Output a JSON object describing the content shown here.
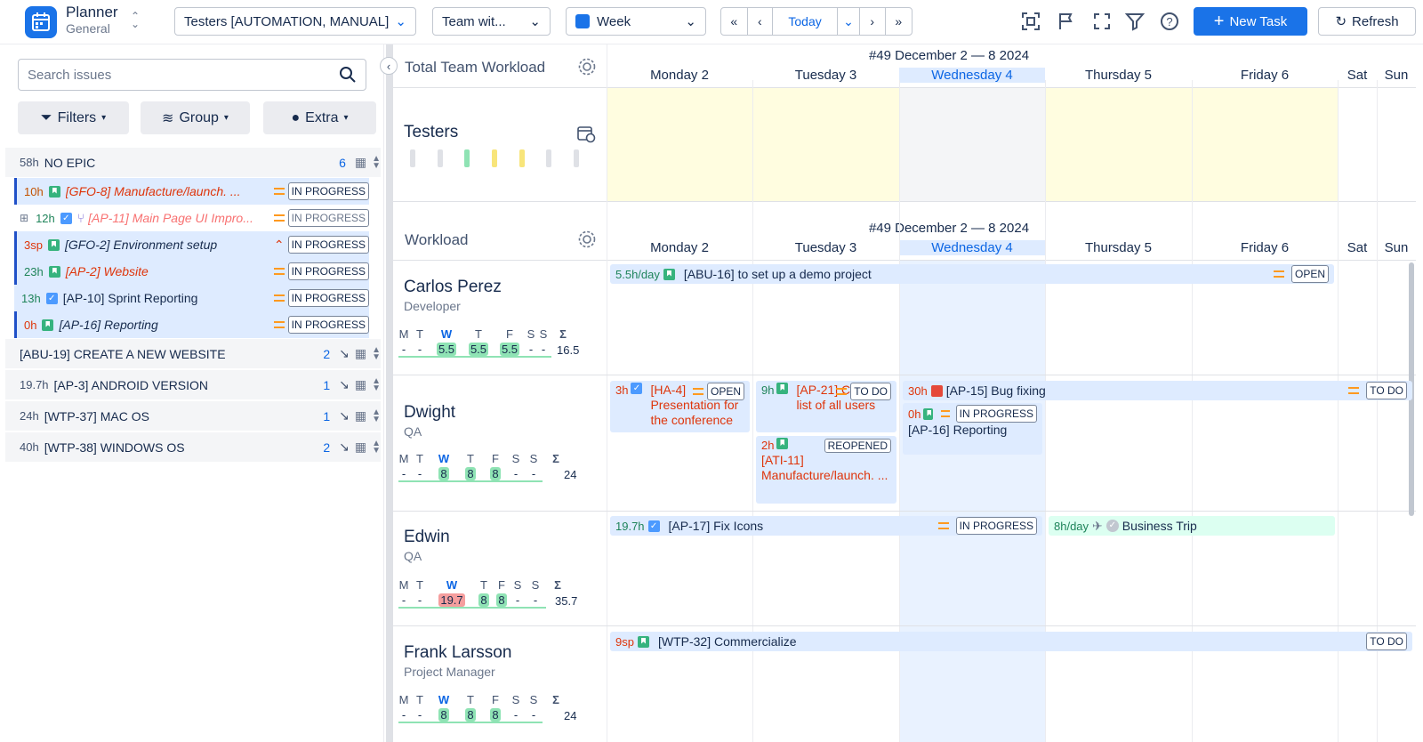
{
  "app": {
    "name": "Planner",
    "subtitle": "General"
  },
  "toolbar": {
    "testers_filter": "Testers [AUTOMATION, MANUAL]",
    "team_filter": "Team wit...",
    "view_select": "Week",
    "today": "Today",
    "new_task": "New Task",
    "refresh": "Refresh",
    "accent": "#1a73e8"
  },
  "left": {
    "search_placeholder": "Search issues",
    "filters": "Filters",
    "group": "Group",
    "extra": "Extra",
    "rows": [
      {
        "hrs": "58h",
        "title": "NO EPIC",
        "count": "6"
      },
      {
        "hrs": "10h",
        "title": "[GFO-8] Manufacture/launch. ...",
        "status": "IN PROGRESS"
      },
      {
        "hrs": "12h",
        "title": "[AP-11] Main Page UI Impro...",
        "status": "IN PROGRESS"
      },
      {
        "hrs": "3sp",
        "title": "[GFO-2] Environment setup",
        "status": "IN PROGRESS"
      },
      {
        "hrs": "23h",
        "title": "[AP-2] Website",
        "status": "IN PROGRESS"
      },
      {
        "hrs": "13h",
        "title": "[AP-10] Sprint Reporting",
        "status": "IN PROGRESS"
      },
      {
        "hrs": "0h",
        "title": "[AP-16] Reporting",
        "status": "IN PROGRESS"
      },
      {
        "hrs": "",
        "title": "[ABU-19] CREATE A NEW WEBSITE",
        "count": "2"
      },
      {
        "hrs": "19.7h",
        "title": "[AP-3] ANDROID VERSION",
        "count": "1"
      },
      {
        "hrs": "24h",
        "title": "[WTP-37] MAC OS",
        "count": "1"
      },
      {
        "hrs": "40h",
        "title": "[WTP-38] WINDOWS OS",
        "count": "2"
      }
    ]
  },
  "team_workload": {
    "title": "Total Team Workload",
    "week_label": "#49 December 2 — 8 2024",
    "group": "Testers",
    "days": [
      "Monday 2",
      "Tuesday 3",
      "Wednesday 4",
      "Thursday 5",
      "Friday 6",
      "Sat",
      "Sun"
    ]
  },
  "workload": {
    "title": "Workload",
    "week_label": "#49 December 2 — 8 2024",
    "days": [
      "Monday 2",
      "Tuesday 3",
      "Wednesday 4",
      "Thursday 5",
      "Friday 6",
      "Sat",
      "Sun"
    ],
    "week_letters": [
      "M",
      "T",
      "W",
      "T",
      "F",
      "S",
      "S",
      "Σ"
    ],
    "people": [
      {
        "name": "Carlos Perez",
        "role": "Developer",
        "vals": [
          "-",
          "-",
          "5.5",
          "5.5",
          "5.5",
          "-",
          "-",
          "16.5"
        ]
      },
      {
        "name": "Dwight",
        "role": "QA",
        "vals": [
          "-",
          "-",
          "8",
          "8",
          "8",
          "-",
          "-",
          "24"
        ]
      },
      {
        "name": "Edwin",
        "role": "QA",
        "vals": [
          "-",
          "-",
          "19.7",
          "8",
          "8",
          "-",
          "-",
          "35.7"
        ]
      },
      {
        "name": "Frank Larsson",
        "role": "Project Manager",
        "vals": [
          "-",
          "-",
          "8",
          "8",
          "8",
          "-",
          "-",
          "24"
        ]
      }
    ],
    "tasks": {
      "carlos_1": {
        "hrs": "5.5h/day",
        "title": "[ABU-16] to set up a demo project",
        "status": "OPEN"
      },
      "dwight_1": {
        "hrs": "3h",
        "title": "[HA-4] Presentation for the conference",
        "status": "OPEN"
      },
      "dwight_2": {
        "hrs": "9h",
        "title": "[AP-21] Create a list of all users",
        "status": "TO DO"
      },
      "dwight_3": {
        "hrs": "2h",
        "title": "[ATI-11] Manufacture/launch. ...",
        "status": "REOPENED"
      },
      "dwight_4": {
        "hrs": "30h",
        "title": "[AP-15] Bug fixing",
        "status": "TO DO"
      },
      "dwight_5": {
        "hrs": "0h",
        "title": "[AP-16] Reporting",
        "status": "IN PROGRESS"
      },
      "edwin_1": {
        "hrs": "19.7h",
        "title": "[AP-17] Fix Icons",
        "status": "IN PROGRESS"
      },
      "edwin_2": {
        "hrs": "8h/day",
        "title": "Business Trip"
      },
      "frank_1": {
        "hrs": "9sp",
        "title": "[WTP-32] Commercialize",
        "status": "TO DO"
      }
    }
  }
}
